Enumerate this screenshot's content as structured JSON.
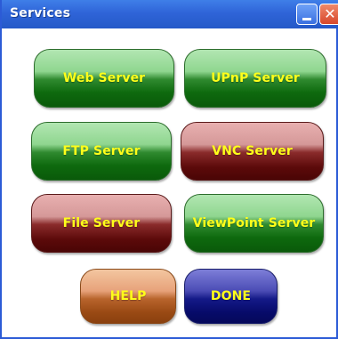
{
  "window": {
    "title": "Services",
    "minimize_icon": "minimize-icon",
    "close_icon": "close-icon",
    "close_glyph": "✕"
  },
  "buttons": {
    "web_server": "Web Server",
    "upnp_server": "UPnP Server",
    "ftp_server": "FTP Server",
    "vnc_server": "VNC Server",
    "file_server": "File Server",
    "viewpoint_server": "ViewPoint Server",
    "help": "HELP",
    "done": "DONE"
  },
  "colors": {
    "titlebar": "#2f64d8",
    "button_text": "#ffff1a",
    "green": "#0e6a0e",
    "red": "#5c0a0a",
    "orange": "#9a4a14",
    "blue": "#070b6a"
  }
}
